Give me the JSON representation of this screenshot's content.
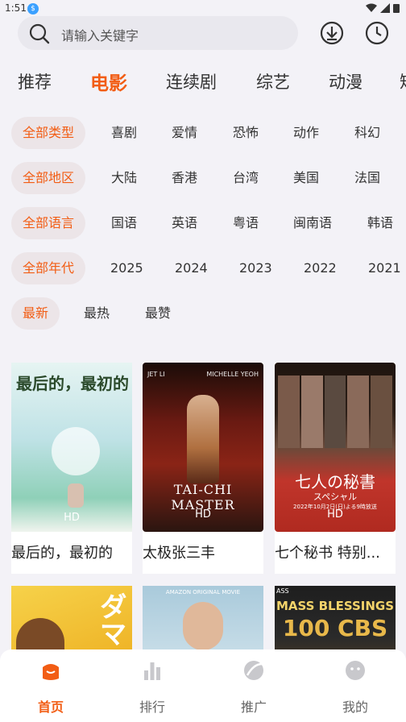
{
  "status": {
    "time": "1:51",
    "app_dot": "$"
  },
  "search": {
    "placeholder": "请输入关键字"
  },
  "tabs": [
    "推荐",
    "电影",
    "连续剧",
    "综艺",
    "动漫",
    "短"
  ],
  "active_tab": 1,
  "filters": {
    "genre": [
      "全部类型",
      "喜剧",
      "爱情",
      "恐怖",
      "动作",
      "科幻"
    ],
    "region": [
      "全部地区",
      "大陆",
      "香港",
      "台湾",
      "美国",
      "法国"
    ],
    "language": [
      "全部语言",
      "国语",
      "英语",
      "粤语",
      "闽南语",
      "韩语"
    ],
    "year": [
      "全部年代",
      "2025",
      "2024",
      "2023",
      "2022",
      "2021"
    ],
    "sort": [
      "最新",
      "最热",
      "最赞"
    ]
  },
  "movies": [
    {
      "title": "最后的，最初的",
      "badge": "HD",
      "poster_text": "最后的，最初的",
      "colors": [
        "#d7eef0",
        "#8fc7d0",
        "#6fb37f"
      ]
    },
    {
      "title": "太极张三丰",
      "badge": "HD",
      "poster_text": "TAI-CHI MASTER",
      "top_left": "JET LI",
      "top_right": "MICHELLE YEOH",
      "colors": [
        "#1a0c08",
        "#7a1a12",
        "#2a1510"
      ]
    },
    {
      "title": "七个秘书 特别...",
      "badge": "HD",
      "poster_text": "七人の秘書",
      "poster_sub": "スペシャル",
      "poster_date": "2022年10月2日(日)よる9時放送",
      "colors": [
        "#2a1c14",
        "#4b2a1a",
        "#c0352b"
      ]
    },
    {
      "title": "",
      "poster_text": "ダマ",
      "colors": [
        "#f4c542",
        "#e0a21a",
        "#7a4a20"
      ]
    },
    {
      "title": "",
      "poster_text": "AMAZON ORIGINAL MOVIE",
      "colors": [
        "#9fc3d6",
        "#c8dde8",
        "#6a8aa0"
      ]
    },
    {
      "title": "",
      "poster_text": "100 CBS",
      "poster_top": "MASS BLESSINGS",
      "poster_tag": "ASS",
      "colors": [
        "#2a2a2a",
        "#b88a2a",
        "#5a3a1a"
      ]
    }
  ],
  "nav": [
    {
      "label": "首页",
      "icon": "home-icon"
    },
    {
      "label": "排行",
      "icon": "ranking-icon"
    },
    {
      "label": "推广",
      "icon": "promote-icon"
    },
    {
      "label": "我的",
      "icon": "profile-icon"
    }
  ],
  "accent": "#f25d14"
}
